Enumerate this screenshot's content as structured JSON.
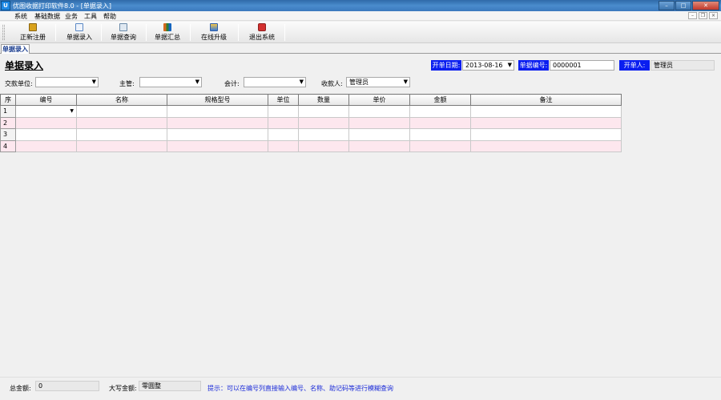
{
  "window": {
    "icon_text": "U",
    "title": "优图收据打印软件8.0 - [单据录入]",
    "controls": {
      "minimize": "–",
      "maximize": "□",
      "close": "✕"
    }
  },
  "menu": {
    "items": [
      "系统",
      "基础数据",
      "业务",
      "工具",
      "帮助"
    ],
    "mdi": {
      "minimize": "–",
      "restore": "❐",
      "close": "×"
    }
  },
  "toolbar": {
    "buttons": [
      {
        "label": "正新注册",
        "icon": "lock-icon",
        "color": "#d9a21b"
      },
      {
        "label": "单据录入",
        "icon": "document-edit-icon",
        "color": "#5b88c5"
      },
      {
        "label": "单据查询",
        "icon": "image-search-icon",
        "color": "#6a8aa9"
      },
      {
        "label": "单据汇总",
        "icon": "bar-chart-icon",
        "color": "#d2691e"
      },
      {
        "label": "在线升级",
        "icon": "upgrade-icon",
        "color": "#3a7bd5"
      },
      {
        "label": "退出系统",
        "icon": "exit-icon",
        "color": "#d3302f"
      }
    ]
  },
  "tabs": [
    {
      "label": "单据录入"
    }
  ],
  "form": {
    "title": "单据录入",
    "date_label": "开单日期:",
    "date_value": "2013-08-16",
    "number_label": "单据编号:",
    "number_value": "0000001",
    "issuer_label": "开单人:",
    "issuer_value": "管理员",
    "payer_label": "交款单位:",
    "payer_value": "",
    "supervisor_label": "主管:",
    "supervisor_value": "",
    "accountant_label": "会计:",
    "accountant_value": "",
    "receiver_label": "收款人:",
    "receiver_value": "管理员",
    "dropdown_arrow": "▼"
  },
  "grid": {
    "columns": [
      "序",
      "编号",
      "名称",
      "规格型号",
      "单位",
      "数量",
      "单价",
      "金额",
      "备注"
    ],
    "rows": [
      {
        "seq": "1",
        "cells": [
          "",
          "",
          "",
          "",
          "",
          "",
          "",
          ""
        ]
      },
      {
        "seq": "2",
        "cells": [
          "",
          "",
          "",
          "",
          "",
          "",
          "",
          ""
        ]
      },
      {
        "seq": "3",
        "cells": [
          "",
          "",
          "",
          "",
          "",
          "",
          "",
          ""
        ]
      },
      {
        "seq": "4",
        "cells": [
          "",
          "",
          "",
          "",
          "",
          "",
          "",
          ""
        ]
      }
    ]
  },
  "status": {
    "total_label": "总金额:",
    "total_value": "0",
    "caps_label": "大写金额:",
    "caps_value": "零圆整",
    "hint": "提示：可以在编号列直接输入编号、名称、助记码等进行模糊查询"
  }
}
